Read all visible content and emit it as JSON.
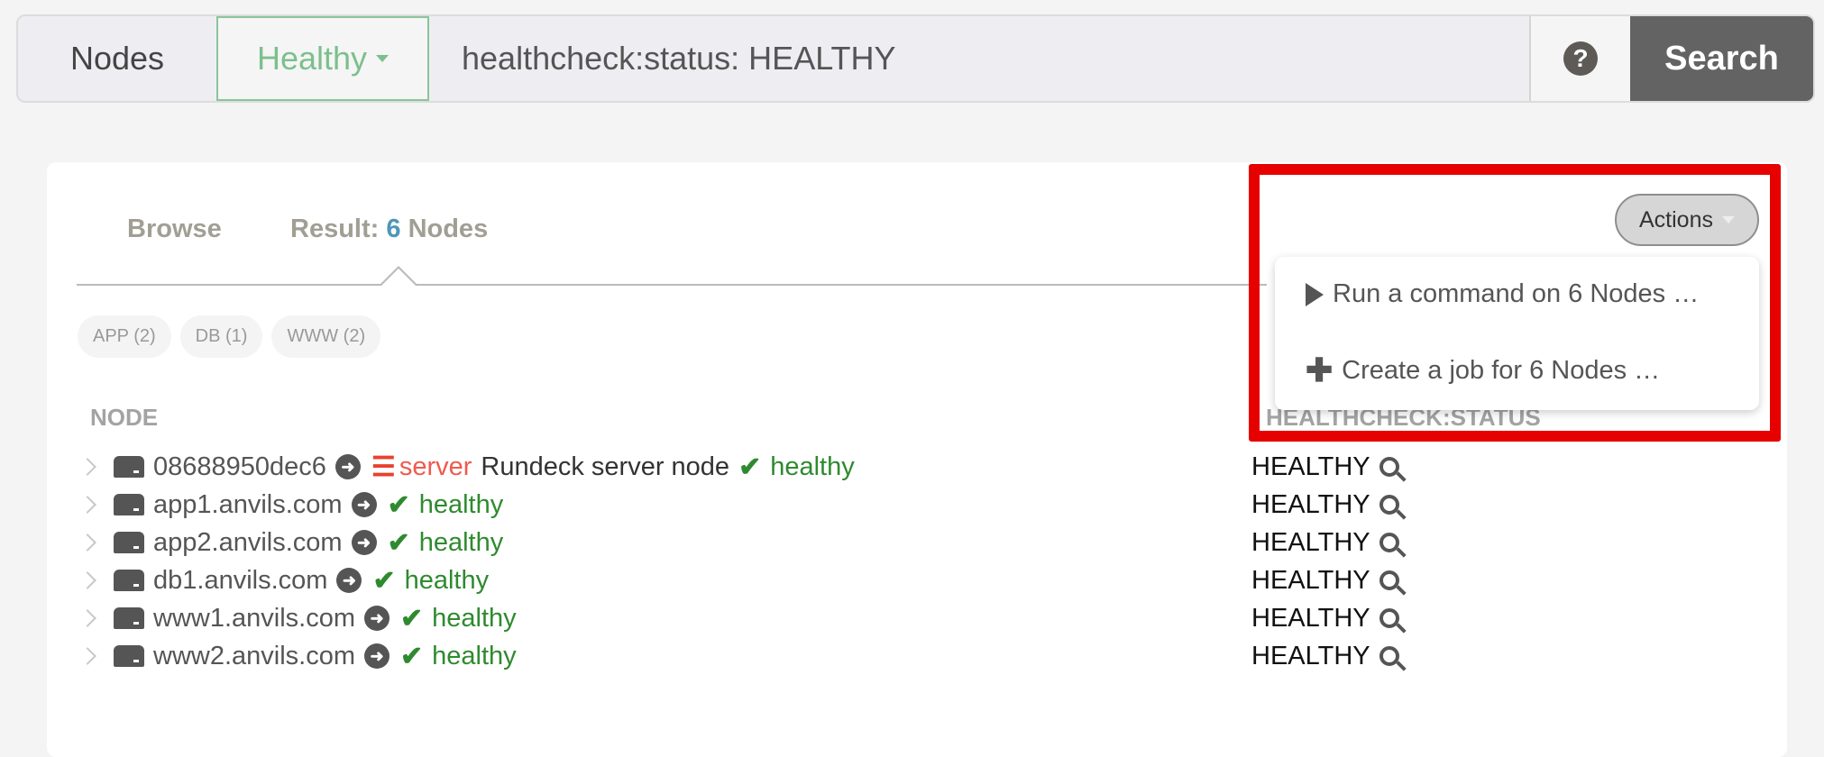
{
  "search_bar": {
    "label": "Nodes",
    "filter": "Healthy",
    "query": "healthcheck:status: HEALTHY",
    "help_icon": "question-circle-icon",
    "search_label": "Search"
  },
  "tabs": {
    "browse": "Browse",
    "result_prefix": "Result:",
    "result_count": "6",
    "result_suffix": "Nodes"
  },
  "tags": [
    "APP (2)",
    "DB (1)",
    "WWW (2)"
  ],
  "columns": {
    "node": "NODE",
    "status": "HEALTHCHECK:STATUS"
  },
  "nodes": [
    {
      "name": "08688950dec6",
      "tag": "server",
      "description": "Rundeck server node",
      "health": "healthy",
      "status": "HEALTHY"
    },
    {
      "name": "app1.anvils.com",
      "health": "healthy",
      "status": "HEALTHY"
    },
    {
      "name": "app2.anvils.com",
      "health": "healthy",
      "status": "HEALTHY"
    },
    {
      "name": "db1.anvils.com",
      "health": "healthy",
      "status": "HEALTHY"
    },
    {
      "name": "www1.anvils.com",
      "health": "healthy",
      "status": "HEALTHY"
    },
    {
      "name": "www2.anvils.com",
      "health": "healthy",
      "status": "HEALTHY"
    }
  ],
  "actions": {
    "label": "Actions",
    "items": [
      "Run a command on 6 Nodes …",
      "Create a job for 6 Nodes …"
    ]
  },
  "colors": {
    "accent_green": "#7cbf8e",
    "healthy": "#2f8a2f",
    "count_blue": "#4f96b8",
    "highlight_red": "#e60000"
  }
}
